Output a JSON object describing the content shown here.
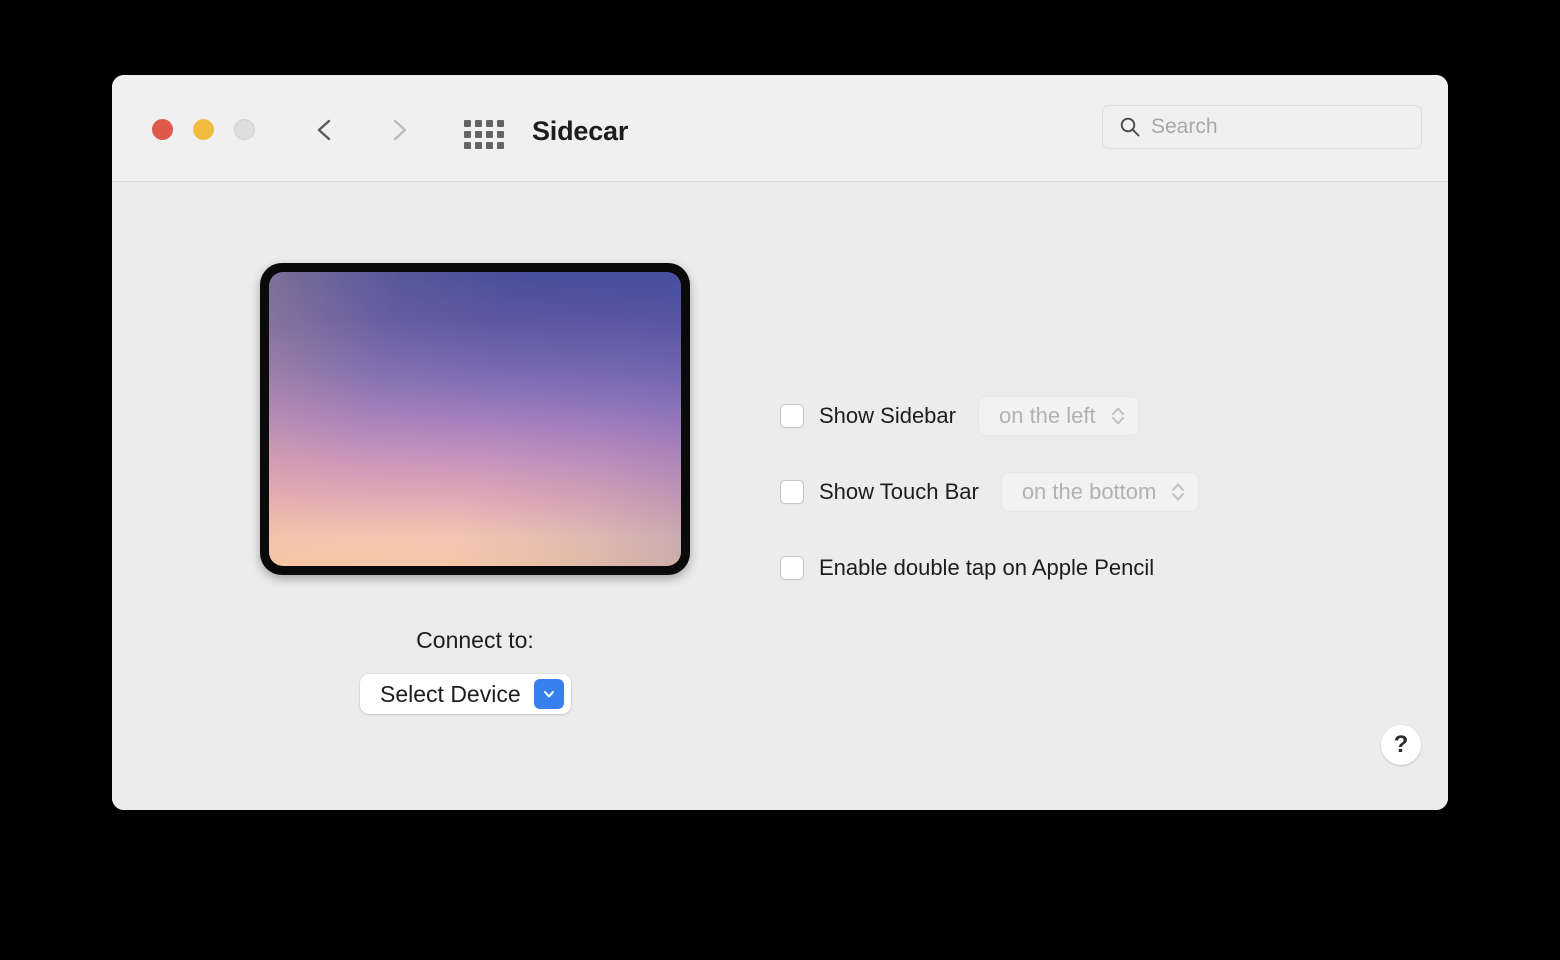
{
  "window": {
    "title": "Sidecar",
    "traffic_lights": [
      {
        "name": "close",
        "color": "#e0574c"
      },
      {
        "name": "minimize",
        "color": "#f0bc40"
      },
      {
        "name": "zoom",
        "color": "#dedede"
      }
    ],
    "nav": {
      "back_label": "Back",
      "forward_label": "Forward"
    },
    "show_all_label": "Show All"
  },
  "search": {
    "placeholder": "Search",
    "value": ""
  },
  "device_preview": {
    "device": "iPad",
    "wallpaper": "sunset-gradient"
  },
  "connect": {
    "label": "Connect to:",
    "selected_device": "Select Device"
  },
  "options": [
    {
      "label": "Show Sidebar",
      "checked": false,
      "popup": {
        "value": "on the left",
        "enabled": false
      }
    },
    {
      "label": "Show Touch Bar",
      "checked": false,
      "popup": {
        "value": "on the bottom",
        "enabled": false
      }
    },
    {
      "label": "Enable double tap on Apple Pencil",
      "checked": false,
      "popup": null
    }
  ],
  "help": {
    "label": "?"
  },
  "colors": {
    "accent": "#3680f0",
    "window_bg": "#ececec",
    "toolbar_bg": "#f0f0f0",
    "text": "#1d1d1f",
    "disabled_text": "#b2b2b2"
  }
}
